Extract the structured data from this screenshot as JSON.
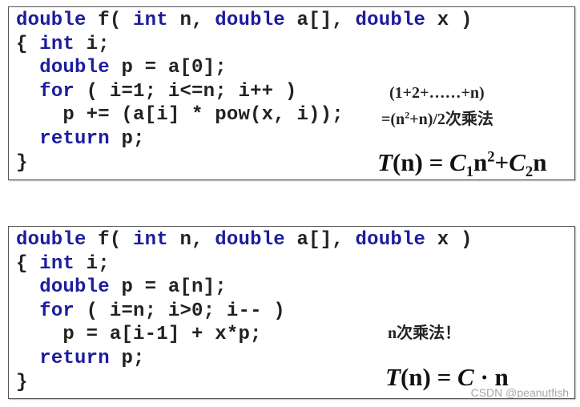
{
  "colors": {
    "keyword": "#1c1c9e",
    "text": "#222222",
    "border": "#555555"
  },
  "slides": [
    {
      "code": [
        [
          [
            "kw",
            "double"
          ],
          [
            "p",
            " f( "
          ],
          [
            "kw",
            "int"
          ],
          [
            "p",
            " n, "
          ],
          [
            "kw",
            "double"
          ],
          [
            "p",
            " a[], "
          ],
          [
            "kw",
            "double"
          ],
          [
            "p",
            " x )"
          ]
        ],
        [
          [
            "p",
            "{ "
          ],
          [
            "kw",
            "int"
          ],
          [
            "p",
            " i;"
          ]
        ],
        [
          [
            "p",
            "  "
          ],
          [
            "kw",
            "double"
          ],
          [
            "p",
            " p = a[0];"
          ]
        ],
        [
          [
            "p",
            "  "
          ],
          [
            "kw",
            "for"
          ],
          [
            "p",
            " ( i=1; i<=n; i++ )"
          ]
        ],
        [
          [
            "p",
            "    p += (a[i] * pow(x, i));"
          ]
        ],
        [
          [
            "p",
            "  "
          ],
          [
            "kw",
            "return"
          ],
          [
            "p",
            " p;"
          ]
        ],
        [
          [
            "p",
            "}"
          ]
        ]
      ],
      "note_line1": "(1+2+……+n)",
      "note_line2_pre": "=(n",
      "note_line2_sup": "2",
      "note_line2_post": "+n)/2次乘法",
      "formula": {
        "T": "T",
        "n_arg": "(n) = ",
        "C1": "C",
        "sub1": "1",
        "n2": "n",
        "sup2": "2",
        "plus": "+",
        "C2": "C",
        "sub2": "2",
        "n": "n"
      }
    },
    {
      "code": [
        [
          [
            "kw",
            "double"
          ],
          [
            "p",
            " f( "
          ],
          [
            "kw",
            "int"
          ],
          [
            "p",
            " n, "
          ],
          [
            "kw",
            "double"
          ],
          [
            "p",
            " a[], "
          ],
          [
            "kw",
            "double"
          ],
          [
            "p",
            " x )"
          ]
        ],
        [
          [
            "p",
            "{ "
          ],
          [
            "kw",
            "int"
          ],
          [
            "p",
            " i;"
          ]
        ],
        [
          [
            "p",
            "  "
          ],
          [
            "kw",
            "double"
          ],
          [
            "p",
            " p = a[n];"
          ]
        ],
        [
          [
            "p",
            "  "
          ],
          [
            "kw",
            "for"
          ],
          [
            "p",
            " ( i=n; i>0; i-- )"
          ]
        ],
        [
          [
            "p",
            "    p = a[i-1] + x*p;"
          ]
        ],
        [
          [
            "p",
            "  "
          ],
          [
            "kw",
            "return"
          ],
          [
            "p",
            " p;"
          ]
        ],
        [
          [
            "p",
            "}"
          ]
        ]
      ],
      "note": "n次乘法！",
      "formula": {
        "T": "T",
        "rest": "(n) = ",
        "C": "C",
        "dot_n": " · n"
      }
    }
  ],
  "watermark": "CSDN @peanutfish"
}
